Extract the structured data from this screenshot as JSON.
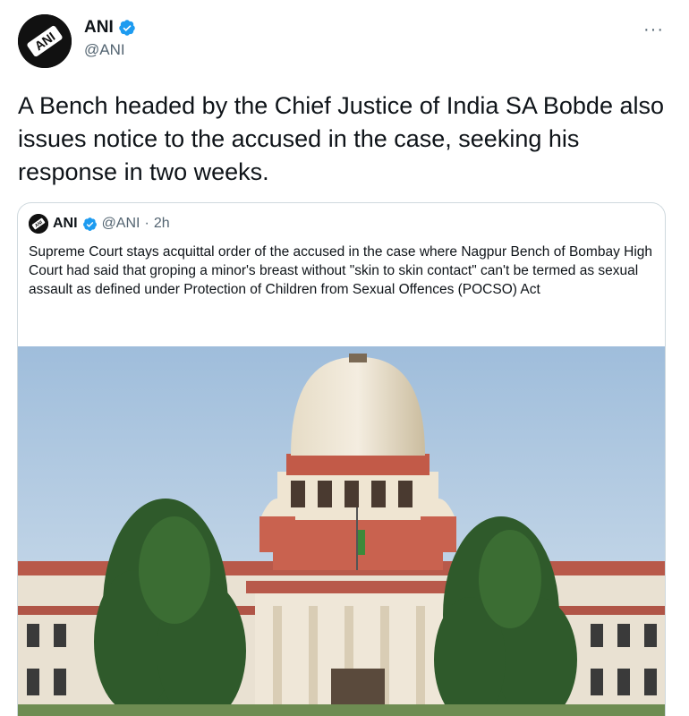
{
  "author": {
    "name": "ANI",
    "handle": "@ANI",
    "avatar_icon": "ani-logo-icon",
    "verified_icon": "verified-badge-icon"
  },
  "more_label": "···",
  "tweet_text": "A Bench headed by the Chief Justice of India SA Bobde also issues notice to the accused in the case, seeking his response in two weeks.",
  "quoted_tweet": {
    "name": "ANI",
    "handle": "@ANI",
    "separator": "·",
    "time": "2h",
    "text": "Supreme Court stays acquittal order of the accused in the case where Nagpur Bench of Bombay High Court had said that groping a minor's breast without \"skin to skin contact\" can't be termed as sexual assault as defined under  Protection of Children from Sexual Offences (POCSO) Act",
    "image": "supreme-court-building-photo"
  },
  "colors": {
    "text": "#0f1419",
    "secondary": "#536471",
    "verified": "#1d9bf0",
    "border": "#cfd9de"
  }
}
